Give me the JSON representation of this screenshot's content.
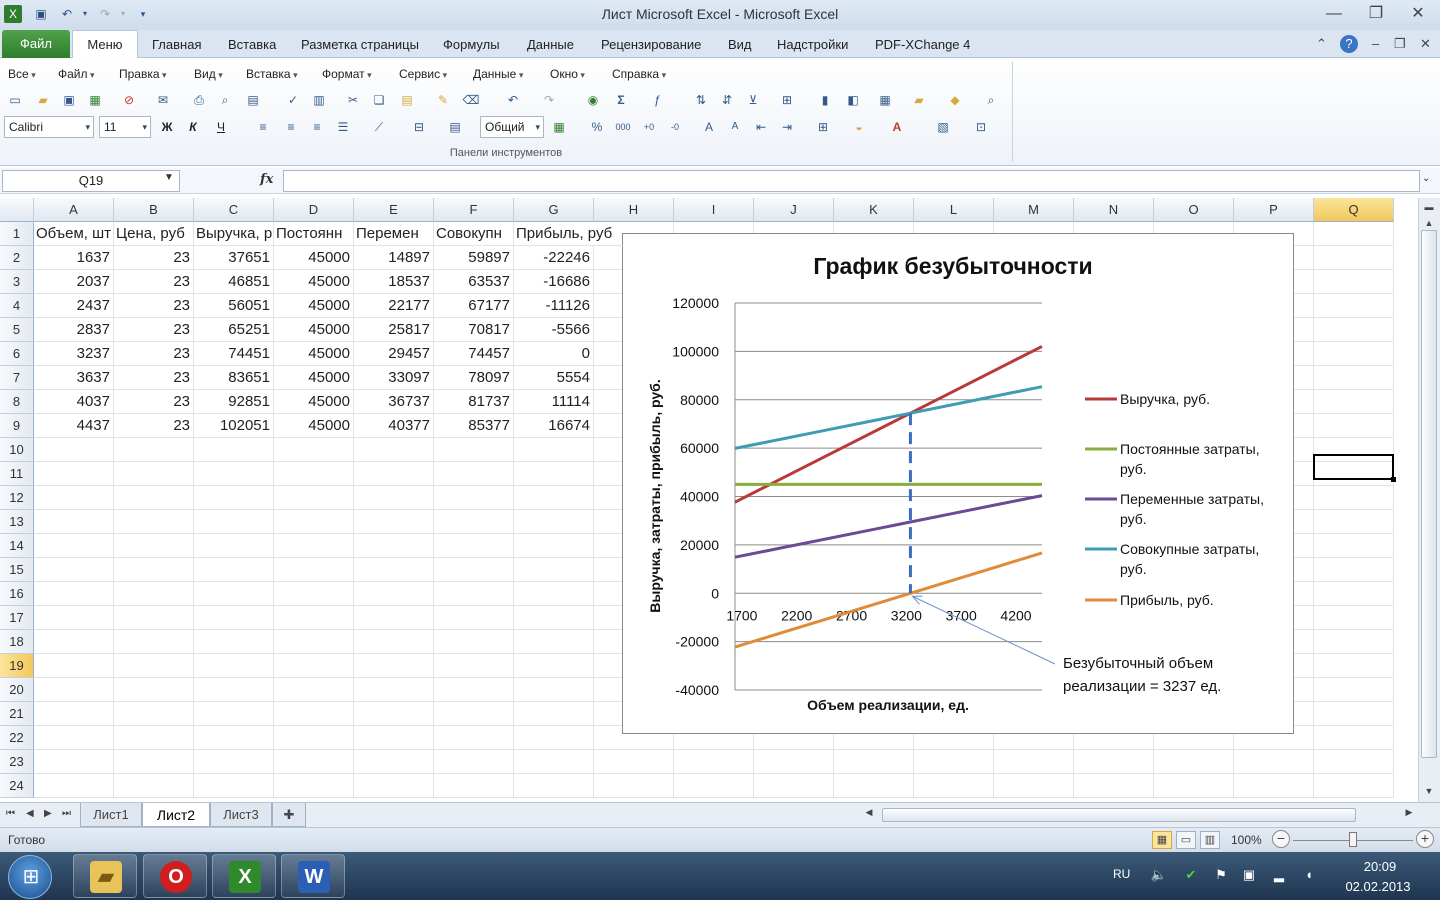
{
  "window": {
    "title": "Лист Microsoft Excel  -  Microsoft Excel"
  },
  "tabs": [
    {
      "label": "Файл"
    },
    {
      "label": "Меню"
    },
    {
      "label": "Главная"
    },
    {
      "label": "Вставка"
    },
    {
      "label": "Разметка страницы"
    },
    {
      "label": "Формулы"
    },
    {
      "label": "Данные"
    },
    {
      "label": "Рецензирование"
    },
    {
      "label": "Вид"
    },
    {
      "label": "Надстройки"
    },
    {
      "label": "PDF-XChange 4"
    }
  ],
  "menu_items": [
    {
      "label": "Все"
    },
    {
      "label": "Файл"
    },
    {
      "label": "Правка"
    },
    {
      "label": "Вид"
    },
    {
      "label": "Вставка"
    },
    {
      "label": "Формат"
    },
    {
      "label": "Сервис"
    },
    {
      "label": "Данные"
    },
    {
      "label": "Окно"
    },
    {
      "label": "Справка"
    }
  ],
  "toolbar": {
    "font_name": "Calibri",
    "font_size": "11",
    "number_format": "Общий",
    "group_label": "Панели инструментов",
    "bold": "Ж",
    "italic": "К",
    "underline": "Ч"
  },
  "formula_bar": {
    "name_box": "Q19",
    "fx": "fx",
    "formula": ""
  },
  "columns": [
    "A",
    "B",
    "C",
    "D",
    "E",
    "F",
    "G",
    "H",
    "I",
    "J",
    "K",
    "L",
    "M",
    "N",
    "O",
    "P",
    "Q"
  ],
  "selected_column": "Q",
  "selected_row": 19,
  "rows": [
    "1",
    "2",
    "3",
    "4",
    "5",
    "6",
    "7",
    "8",
    "9",
    "10",
    "11",
    "12",
    "13",
    "14",
    "15",
    "16",
    "17",
    "18",
    "19",
    "20",
    "21",
    "22",
    "23",
    "24"
  ],
  "headers": [
    "Объем, шт",
    "Цена, руб",
    "Выручка, р",
    "Постоянн",
    "Перемен",
    "Совокупн",
    "Прибыль, руб"
  ],
  "table": [
    [
      "1637",
      "23",
      "37651",
      "45000",
      "14897",
      "59897",
      "-22246"
    ],
    [
      "2037",
      "23",
      "46851",
      "45000",
      "18537",
      "63537",
      "-16686"
    ],
    [
      "2437",
      "23",
      "56051",
      "45000",
      "22177",
      "67177",
      "-11126"
    ],
    [
      "2837",
      "23",
      "65251",
      "45000",
      "25817",
      "70817",
      "-5566"
    ],
    [
      "3237",
      "23",
      "74451",
      "45000",
      "29457",
      "74457",
      "0"
    ],
    [
      "3637",
      "23",
      "83651",
      "45000",
      "33097",
      "78097",
      "5554"
    ],
    [
      "4037",
      "23",
      "92851",
      "45000",
      "36737",
      "81737",
      "11114"
    ],
    [
      "4437",
      "23",
      "102051",
      "45000",
      "40377",
      "85377",
      "16674"
    ]
  ],
  "chart_data": {
    "type": "line",
    "title": "График безубыточности",
    "xlabel": "Объем реализации, ед.",
    "ylabel": "Выручка, затраты, прибыль, руб.",
    "x": [
      1637,
      2037,
      2437,
      2837,
      3237,
      3637,
      4037,
      4437
    ],
    "xlim": [
      1637,
      4437
    ],
    "ylim": [
      -40000,
      120000
    ],
    "x_ticks": [
      "1700",
      "2200",
      "2700",
      "3200",
      "3700",
      "4200"
    ],
    "x_tick_values": [
      1700,
      2200,
      2700,
      3200,
      3700,
      4200
    ],
    "y_ticks": [
      "120000",
      "100000",
      "80000",
      "60000",
      "40000",
      "20000",
      "0",
      "-20000",
      "-40000"
    ],
    "y_tick_values": [
      120000,
      100000,
      80000,
      60000,
      40000,
      20000,
      0,
      -20000,
      -40000
    ],
    "grid": true,
    "legend_position": "right",
    "series": [
      {
        "name": "Выручка, руб.",
        "color": "#b83a38",
        "values": [
          37651,
          46851,
          56051,
          65251,
          74451,
          83651,
          92851,
          102051
        ]
      },
      {
        "name": "Постоянные затраты, руб.",
        "color": "#8aab3e",
        "values": [
          45000,
          45000,
          45000,
          45000,
          45000,
          45000,
          45000,
          45000
        ]
      },
      {
        "name": "Переменные затраты, руб.",
        "color": "#6a4b94",
        "values": [
          14897,
          18537,
          22177,
          25817,
          29457,
          33097,
          36737,
          40377
        ]
      },
      {
        "name": "Совокупные затраты, руб.",
        "color": "#3f9cb4",
        "values": [
          59897,
          63537,
          67177,
          70817,
          74457,
          78097,
          81737,
          85377
        ]
      },
      {
        "name": "Прибыль, руб.",
        "color": "#e08a3a",
        "values": [
          -22246,
          -16686,
          -11126,
          -5566,
          0,
          5554,
          11114,
          16674
        ]
      }
    ],
    "breakeven": {
      "x": 3237,
      "y_top": 74451,
      "line_color": "#3a6ebc",
      "annotation_lines": [
        "Безубыточный объем",
        "реализации = 3237  ед."
      ]
    }
  },
  "sheets": [
    {
      "label": "Лист1"
    },
    {
      "label": "Лист2"
    },
    {
      "label": "Лист3"
    }
  ],
  "active_sheet": 1,
  "status": {
    "text": "Готово",
    "zoom": "100%"
  },
  "taskbar": {
    "lang": "RU",
    "time": "20:09",
    "date": "02.02.2013"
  }
}
